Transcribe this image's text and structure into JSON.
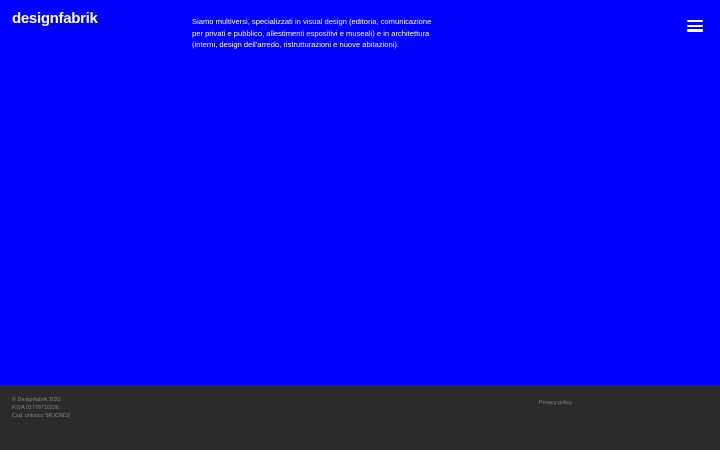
{
  "header": {
    "logo": "designfabrik",
    "intro": "Siamo multiversi, specializzati in visual design (editoria, comunicazione per privati e pubblico, allestimenti espositivi e museali) e in architettura (interni, design dell'arredo, ristrutturazioni e nuove abitazioni).",
    "menu_icon": "hamburger-menu-icon"
  },
  "footer": {
    "copyright": "© Designfabrik 2021",
    "vat": "P.IVA 01778710226",
    "sdi_code": "Cod. univoco SRJCRD3",
    "privacy_label": "Privacy policy"
  },
  "colors": {
    "hero_background": "#0000fd",
    "footer_background": "#2b2b2b",
    "text_primary": "#ffffff",
    "text_muted": "#8a8a8a"
  }
}
